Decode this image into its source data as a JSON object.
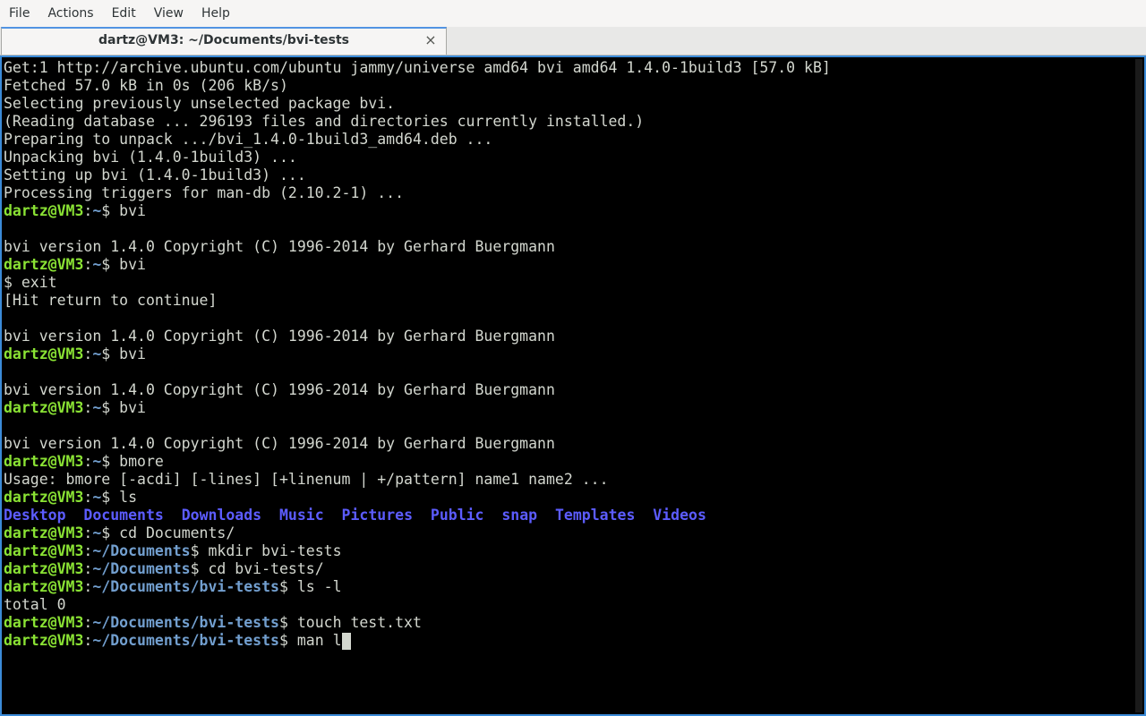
{
  "menubar": {
    "items": [
      {
        "label": "File"
      },
      {
        "label": "Actions"
      },
      {
        "label": "Edit"
      },
      {
        "label": "View"
      },
      {
        "label": "Help"
      }
    ]
  },
  "tab": {
    "title": "dartz@VM3: ~/Documents/bvi-tests",
    "close_glyph": "×"
  },
  "terminal": {
    "lines": [
      {
        "type": "out",
        "text": "Get:1 http://archive.ubuntu.com/ubuntu jammy/universe amd64 bvi amd64 1.4.0-1build3 [57.0 kB]"
      },
      {
        "type": "out",
        "text": "Fetched 57.0 kB in 0s (206 kB/s)"
      },
      {
        "type": "out",
        "text": "Selecting previously unselected package bvi."
      },
      {
        "type": "out",
        "text": "(Reading database ... 296193 files and directories currently installed.)"
      },
      {
        "type": "out",
        "text": "Preparing to unpack .../bvi_1.4.0-1build3_amd64.deb ..."
      },
      {
        "type": "out",
        "text": "Unpacking bvi (1.4.0-1build3) ..."
      },
      {
        "type": "out",
        "text": "Setting up bvi (1.4.0-1build3) ..."
      },
      {
        "type": "out",
        "text": "Processing triggers for man-db (2.10.2-1) ..."
      },
      {
        "type": "prompt",
        "user": "dartz@VM3",
        "path": "~",
        "cmd": " bvi"
      },
      {
        "type": "out",
        "text": ""
      },
      {
        "type": "out",
        "text": "bvi version 1.4.0 Copyright (C) 1996-2014 by Gerhard Buergmann"
      },
      {
        "type": "prompt",
        "user": "dartz@VM3",
        "path": "~",
        "cmd": " bvi"
      },
      {
        "type": "out",
        "text": "$ exit"
      },
      {
        "type": "out",
        "text": "[Hit return to continue]"
      },
      {
        "type": "out",
        "text": ""
      },
      {
        "type": "out",
        "text": "bvi version 1.4.0 Copyright (C) 1996-2014 by Gerhard Buergmann"
      },
      {
        "type": "prompt",
        "user": "dartz@VM3",
        "path": "~",
        "cmd": " bvi"
      },
      {
        "type": "out",
        "text": ""
      },
      {
        "type": "out",
        "text": "bvi version 1.4.0 Copyright (C) 1996-2014 by Gerhard Buergmann"
      },
      {
        "type": "prompt",
        "user": "dartz@VM3",
        "path": "~",
        "cmd": " bvi"
      },
      {
        "type": "out",
        "text": ""
      },
      {
        "type": "out",
        "text": "bvi version 1.4.0 Copyright (C) 1996-2014 by Gerhard Buergmann"
      },
      {
        "type": "prompt",
        "user": "dartz@VM3",
        "path": "~",
        "cmd": " bmore"
      },
      {
        "type": "out",
        "text": "Usage: bmore [-acdi] [-lines] [+linenum | +/pattern] name1 name2 ..."
      },
      {
        "type": "prompt",
        "user": "dartz@VM3",
        "path": "~",
        "cmd": " ls"
      },
      {
        "type": "ls",
        "items": [
          "Desktop",
          "Documents",
          "Downloads",
          "Music",
          "Pictures",
          "Public",
          "snap",
          "Templates",
          "Videos"
        ]
      },
      {
        "type": "prompt",
        "user": "dartz@VM3",
        "path": "~",
        "cmd": " cd Documents/"
      },
      {
        "type": "prompt",
        "user": "dartz@VM3",
        "path": "~/Documents",
        "cmd": " mkdir bvi-tests"
      },
      {
        "type": "prompt",
        "user": "dartz@VM3",
        "path": "~/Documents",
        "cmd": " cd bvi-tests/"
      },
      {
        "type": "prompt",
        "user": "dartz@VM3",
        "path": "~/Documents/bvi-tests",
        "cmd": " ls -l"
      },
      {
        "type": "out",
        "text": "total 0"
      },
      {
        "type": "prompt",
        "user": "dartz@VM3",
        "path": "~/Documents/bvi-tests",
        "cmd": " touch test.txt"
      },
      {
        "type": "prompt",
        "user": "dartz@VM3",
        "path": "~/Documents/bvi-tests",
        "cmd": " man l",
        "cursor": true
      }
    ]
  },
  "colors": {
    "prompt_user": "#8ae234",
    "prompt_path": "#729fcf",
    "dir_listing": "#5c5cff",
    "foreground": "#d3d7cf",
    "background": "#000000",
    "focus_border": "#3b8bd8"
  }
}
